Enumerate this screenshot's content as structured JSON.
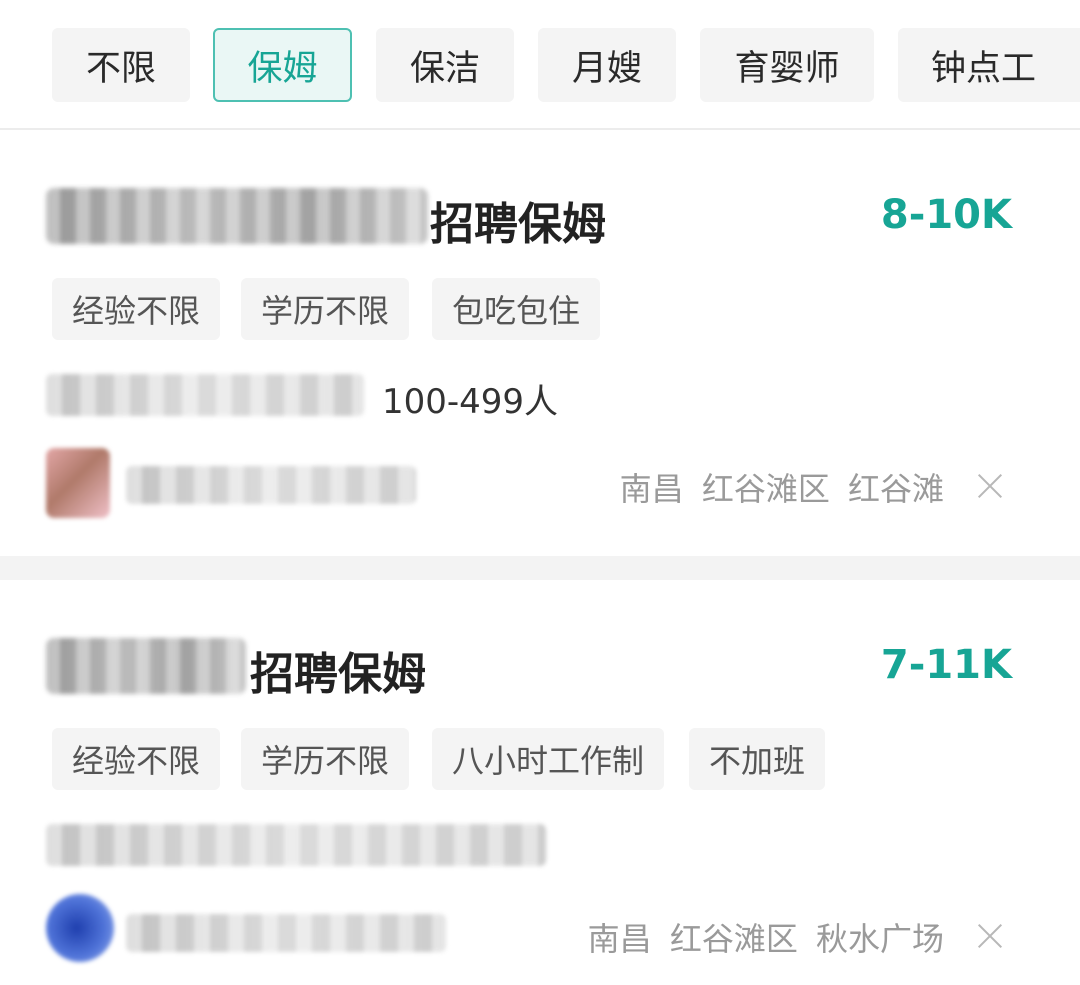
{
  "filters": [
    {
      "label": "不限",
      "active": false
    },
    {
      "label": "保姆",
      "active": true
    },
    {
      "label": "保洁",
      "active": false
    },
    {
      "label": "月嫂",
      "active": false
    },
    {
      "label": "育婴师",
      "active": false
    },
    {
      "label": "钟点工",
      "active": false
    }
  ],
  "jobs": [
    {
      "title_suffix": "招聘保姆",
      "salary": "8-10K",
      "tags": [
        "经验不限",
        "学历不限",
        "包吃包住"
      ],
      "company_size": "100-499人",
      "location": "南昌  红谷滩区  红谷滩"
    },
    {
      "title_suffix": "招聘保姆",
      "salary": "7-11K",
      "tags": [
        "经验不限",
        "学历不限",
        "八小时工作制",
        "不加班"
      ],
      "company_size": "",
      "location": "南昌  红谷滩区  秋水广场"
    }
  ],
  "colors": {
    "accent": "#17a595",
    "active_border": "#4ec0b2"
  }
}
